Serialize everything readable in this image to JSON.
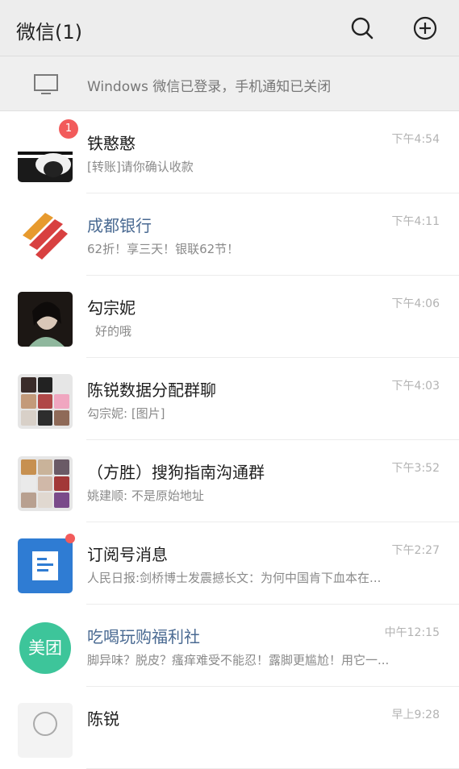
{
  "header": {
    "title": "微信(1)",
    "icons": [
      "search-icon",
      "add-icon"
    ]
  },
  "notice": {
    "text": "Windows 微信已登录，手机通知已关闭",
    "icon": "computer-icon"
  },
  "chats": [
    {
      "name": "铁憨憨",
      "preview": "[转账]请你确认收款",
      "time": "下午4:54",
      "badge": "1"
    },
    {
      "name": "成都银行",
      "preview": "62折！享三天！银联62节！",
      "time": "下午4:11"
    },
    {
      "name": "勾宗妮",
      "preview": "好的哦",
      "time": "下午4:06"
    },
    {
      "name": "陈锐数据分配群聊",
      "preview": "勾宗妮: [图片]",
      "time": "下午4:03"
    },
    {
      "name": "（方胜）搜狗指南沟通群",
      "preview": "姚建顺: 不是原始地址",
      "time": "下午3:52"
    },
    {
      "name": "订阅号消息",
      "preview": "人民日报:剑桥博士发震撼长文：为何中国肯下血本在...",
      "time": "下午2:27"
    },
    {
      "name": "吃喝玩购福利社",
      "preview": "脚异味？脱皮？瘙痒难受不能忍！露脚更尴尬！用它一...",
      "time": "中午12:15",
      "avatar_text": "美团"
    },
    {
      "name": "陈锐",
      "preview": "",
      "time": "早上9:28"
    }
  ],
  "colors": {
    "header_bg": "#ededed",
    "badge": "#f25b5b",
    "link_name": "#4a6a92",
    "meituan": "#3dc59a",
    "subscription": "#2f7cd3"
  }
}
